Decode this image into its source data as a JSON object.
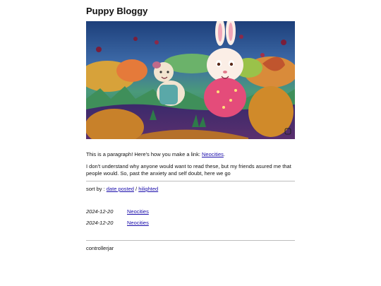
{
  "blog": {
    "title": "Puppy Bloggy"
  },
  "intro": {
    "p1_text": "This is a paragraph! Here's how you make a link: ",
    "p1_link": "Neocities",
    "p1_end": ".",
    "p2_text": "I don't understand why anyone would want to read these, but my friends asured me that people would. So, past the anxiety and self doubt, here we go"
  },
  "sort": {
    "label": "sort by : ",
    "option_date": "date posted",
    "separator": " / ",
    "option_highlighted": "hilighted"
  },
  "posts": [
    {
      "date": "2024-12-20",
      "title": "Neocities"
    },
    {
      "date": "2024-12-20",
      "title": "Neocities"
    }
  ],
  "footer": {
    "author": "controllerjar"
  },
  "colors": {
    "link": "#1a0dab",
    "divider": "#bdbdbd"
  },
  "hero_image": {
    "subject": "illustration-rabbit-and-hamster-in-garden"
  }
}
